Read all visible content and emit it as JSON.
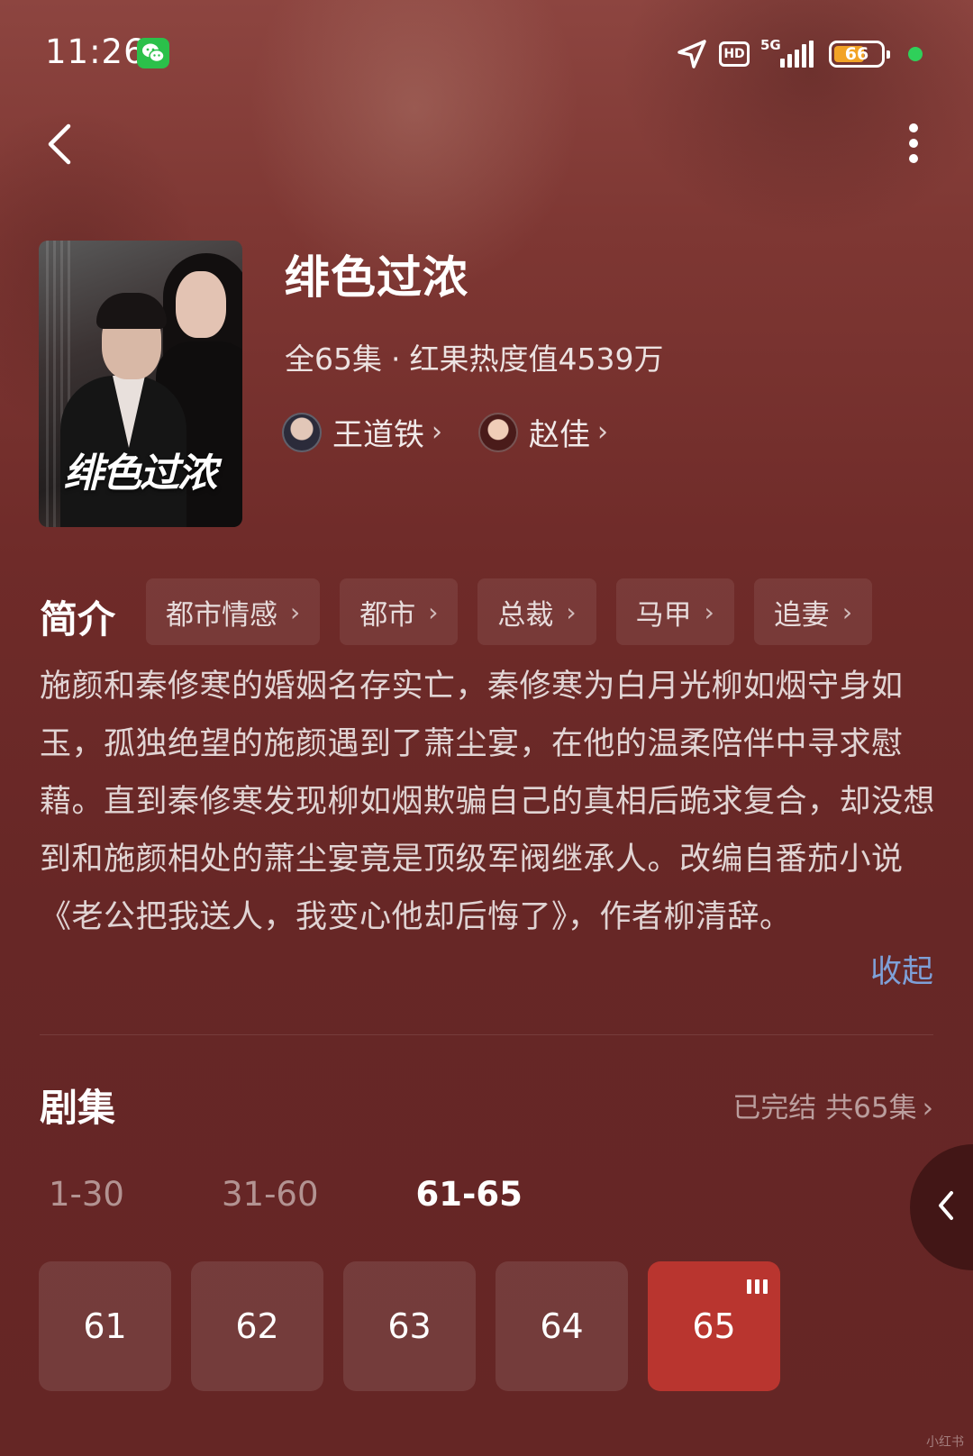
{
  "status_bar": {
    "time": "11:26",
    "battery": "66",
    "network": "5G",
    "hd": "HD"
  },
  "icons": {
    "back": "chevron-left-icon",
    "more": "more-vertical-icon",
    "wechat": "wechat-icon",
    "location": "location-arrow-icon",
    "battery": "battery-icon",
    "playing": "playing-bars-icon"
  },
  "colors": {
    "background": "#6a2725",
    "accent": "#b9352f",
    "link": "#7ea0d8",
    "battery": "#f2a326",
    "online": "#2fd05a"
  },
  "header": {
    "poster_title": "绯色过浓",
    "title": "绯色过浓",
    "episode_count": "全65集",
    "separator": "·",
    "heat": "红果热度值4539万",
    "cast": [
      {
        "name": "王道铁"
      },
      {
        "name": "赵佳"
      }
    ]
  },
  "intro": {
    "label": "简介",
    "tags": [
      "都市情感",
      "都市",
      "总裁",
      "马甲",
      "追妻"
    ],
    "synopsis": "施颜和秦修寒的婚姻名存实亡，秦修寒为白月光柳如烟守身如玉，孤独绝望的施颜遇到了萧尘宴，在他的温柔陪伴中寻求慰藉。直到秦修寒发现柳如烟欺骗自己的真相后跪求复合，却没想到和施颜相处的萧尘宴竟是顶级军阀继承人。改编自番茄小说《老公把我送人，我变心他却后悔了》，作者柳清辞。",
    "collapse": "收起"
  },
  "episodes": {
    "label": "剧集",
    "status": "已完结 共65集",
    "ranges": [
      "1-30",
      "31-60",
      "61-65"
    ],
    "active_range": 2,
    "items": [
      "61",
      "62",
      "63",
      "64",
      "65"
    ],
    "active_item": 4
  },
  "watermark": "小红书"
}
